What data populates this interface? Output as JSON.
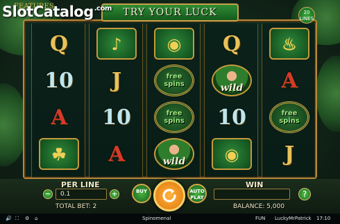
{
  "watermark": {
    "brand": "SlotCatalog",
    "tld": ".com"
  },
  "header": {
    "features_label": "FEATURES",
    "banner": "TRY YOUR LUCK",
    "lines_badge": "20 LINES"
  },
  "reels": [
    [
      {
        "type": "card",
        "text": "Q",
        "tone": "gold",
        "icon": "q-card-icon"
      },
      {
        "type": "card",
        "text": "10",
        "tone": "teal",
        "icon": "ten-card-icon"
      },
      {
        "type": "card",
        "text": "A",
        "tone": "red",
        "icon": "ace-card-icon"
      },
      {
        "type": "tile",
        "icon": "shamrock-icon"
      }
    ],
    [
      {
        "type": "tile",
        "icon": "harp-icon"
      },
      {
        "type": "card",
        "text": "J",
        "tone": "gold",
        "icon": "jack-card-icon"
      },
      {
        "type": "card",
        "text": "10",
        "tone": "teal",
        "icon": "ten-card-icon"
      },
      {
        "type": "card",
        "text": "A",
        "tone": "red",
        "icon": "ace-card-icon"
      }
    ],
    [
      {
        "type": "tile",
        "icon": "pot-of-gold-icon"
      },
      {
        "type": "free",
        "line1": "free",
        "line2": "spins",
        "icon": "free-spins-scatter-icon"
      },
      {
        "type": "free",
        "line1": "free",
        "line2": "spins",
        "icon": "free-spins-scatter-icon"
      },
      {
        "type": "wild",
        "text": "wild",
        "icon": "leprechaun-wild-icon"
      }
    ],
    [
      {
        "type": "card",
        "text": "Q",
        "tone": "gold",
        "icon": "q-card-icon"
      },
      {
        "type": "wild",
        "text": "wild",
        "icon": "leprechaun-wild-icon"
      },
      {
        "type": "card",
        "text": "10",
        "tone": "teal",
        "icon": "ten-card-icon"
      },
      {
        "type": "tile",
        "icon": "pot-of-gold-icon"
      }
    ],
    [
      {
        "type": "tile",
        "icon": "beer-mug-icon"
      },
      {
        "type": "card",
        "text": "A",
        "tone": "red",
        "icon": "ace-card-icon"
      },
      {
        "type": "free",
        "line1": "free",
        "line2": "spins",
        "icon": "free-spins-scatter-icon"
      },
      {
        "type": "card",
        "text": "J",
        "tone": "gold",
        "icon": "jack-card-icon"
      }
    ]
  ],
  "controls": {
    "per_line_label": "PER LINE",
    "per_line_value": "0.1",
    "minus": "−",
    "plus": "+",
    "total_bet": "TOTAL BET: 2",
    "buy_label": "BUY",
    "auto_label": "AUTO PLAY",
    "win_label": "WIN",
    "win_value": "",
    "help_label": "?",
    "balance": "BALANCE: 5,000"
  },
  "status": {
    "provider": "Spinomenal",
    "mode": "FUN",
    "user": "LuckyMrPatrick",
    "time": "17:10"
  },
  "colors": {
    "frame_gold": "#b8893a",
    "accent_green": "#2f8c34",
    "spin_orange": "#f59a1e"
  }
}
